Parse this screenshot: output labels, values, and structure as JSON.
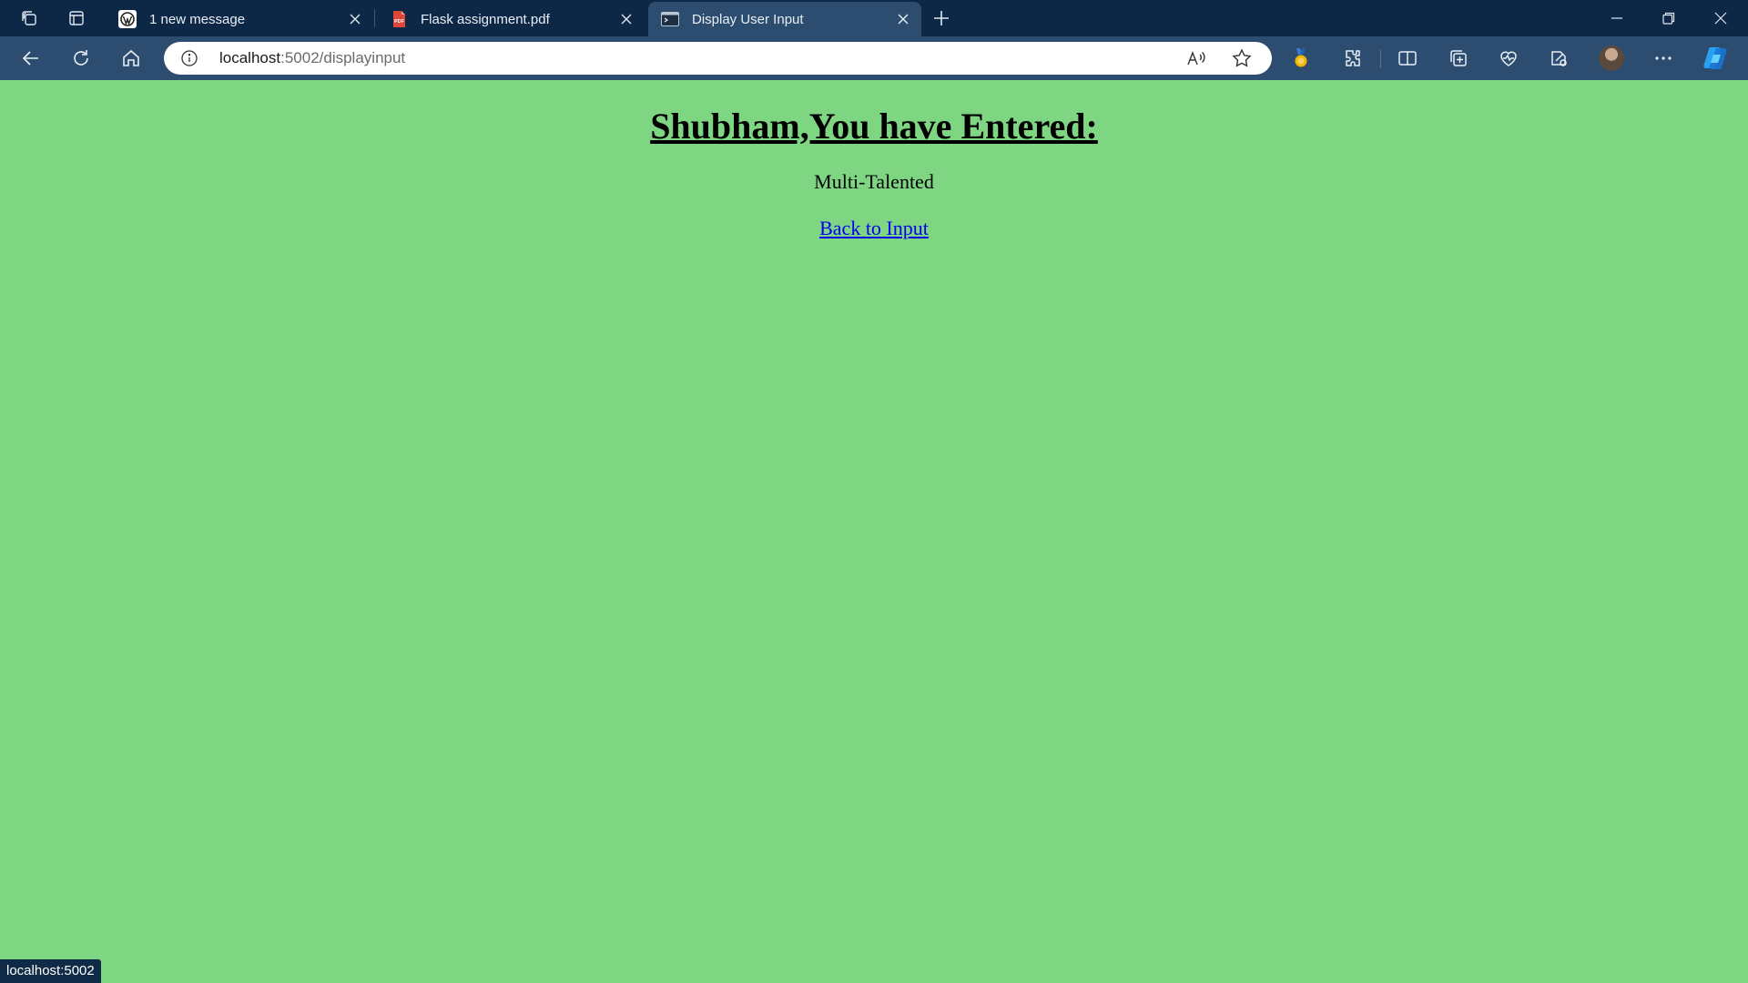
{
  "browser": {
    "tabs": [
      {
        "title": "1 new message",
        "favicon": "wordpress-icon",
        "active": false
      },
      {
        "title": "Flask assignment.pdf",
        "favicon": "pdf-icon",
        "active": false
      },
      {
        "title": "Display User Input",
        "favicon": "terminal-page-icon",
        "active": true
      }
    ],
    "address": {
      "host": "localhost",
      "path": ":5002/displayinput"
    },
    "status_url": "localhost:5002",
    "colors": {
      "tabstrip": "#0d2847",
      "toolbar": "#2c4d6f",
      "page_background": "#7ed683",
      "link": "#0000ee"
    }
  },
  "page": {
    "heading": "Shubham,You have Entered:",
    "entered_value": "Multi-Talented",
    "back_link": "Back to Input"
  }
}
